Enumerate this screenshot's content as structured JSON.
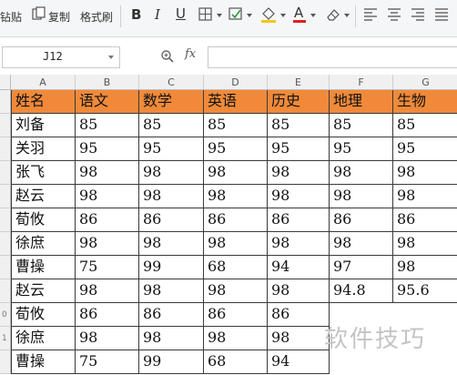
{
  "toolbar": {
    "paste_label": "钻贴",
    "copy_label": "复制",
    "format_painter_label": "格式刷",
    "bold_label": "B",
    "italic_label": "I",
    "underline_label": "U",
    "font_color_label": "A",
    "font_color_accent": "#e02020",
    "fill_color_accent": "#f5c518"
  },
  "formula_bar": {
    "name_box_value": "J12",
    "fx_label": "fx",
    "formula_value": ""
  },
  "sheet": {
    "column_letters": [
      "A",
      "B",
      "C",
      "D",
      "E",
      "F",
      "G"
    ],
    "header_fill": "#f08a3a",
    "header_row": [
      "姓名",
      "语文",
      "数学",
      "英语",
      "历史",
      "地理",
      "生物"
    ],
    "rows": [
      [
        "刘备",
        "85",
        "85",
        "85",
        "85",
        "85",
        "85"
      ],
      [
        "关羽",
        "95",
        "95",
        "95",
        "95",
        "95",
        "95"
      ],
      [
        "张飞",
        "98",
        "98",
        "98",
        "98",
        "98",
        "98"
      ],
      [
        "赵云",
        "98",
        "98",
        "98",
        "98",
        "98",
        "98"
      ],
      [
        "荀攸",
        "86",
        "86",
        "86",
        "86",
        "86",
        "86"
      ],
      [
        "徐庶",
        "98",
        "98",
        "98",
        "98",
        "98",
        "98"
      ],
      [
        "曹操",
        "75",
        "99",
        "68",
        "94",
        "97",
        "98"
      ],
      [
        "赵云",
        "98",
        "98",
        "98",
        "98",
        "94.8",
        "95.6"
      ],
      [
        "荀攸",
        "86",
        "86",
        "86",
        "86",
        "",
        ""
      ],
      [
        "徐庶",
        "98",
        "98",
        "98",
        "98",
        "",
        ""
      ],
      [
        "曹操",
        "75",
        "99",
        "68",
        "94",
        "",
        ""
      ]
    ],
    "row_numbers_visible": [
      "0",
      "1"
    ]
  },
  "watermark": {
    "text": "软件技巧"
  }
}
